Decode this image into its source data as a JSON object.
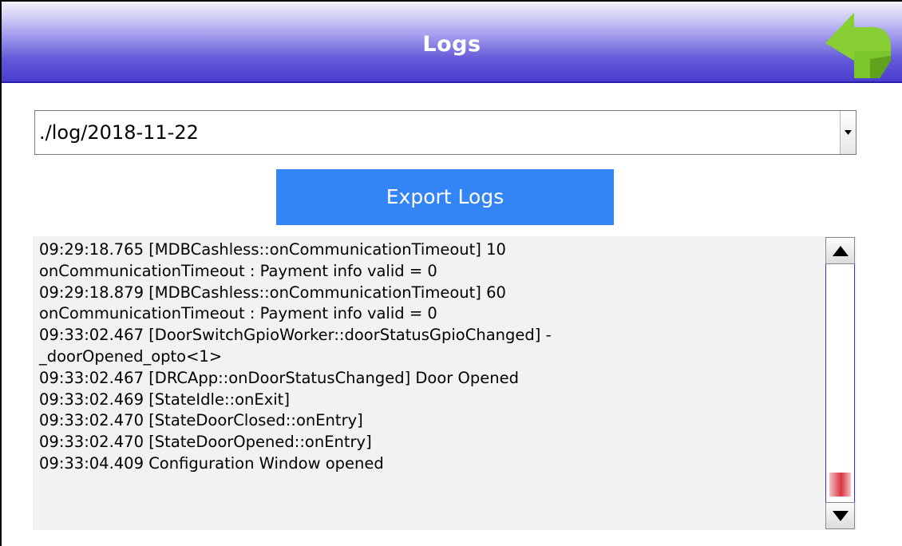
{
  "header": {
    "title": "Logs",
    "back_icon": "back-arrow-icon",
    "back_icon_color": "#7cc52a"
  },
  "log_file_select": {
    "value": "./log/2018-11-22",
    "arrow_icon": "chevron-down-icon"
  },
  "export_button": {
    "label": "Export Logs",
    "color": "#3384f5"
  },
  "log": {
    "lines": [
      "09:29:18.765 [MDBCashless::onCommunicationTimeout] 10",
      "onCommunicationTimeout : Payment info valid = 0",
      "09:29:18.879 [MDBCashless::onCommunicationTimeout] 60",
      "onCommunicationTimeout : Payment info valid = 0",
      "09:33:02.467 [DoorSwitchGpioWorker::doorStatusGpioChanged] -",
      "_doorOpened_opto<1>",
      "09:33:02.467 [DRCApp::onDoorStatusChanged] Door Opened",
      "09:33:02.469 [StateIdle::onExit]",
      "09:33:02.470 [StateDoorClosed::onEntry]",
      "09:33:02.470 [StateDoorOpened::onEntry]",
      "09:33:04.409 Configuration Window opened"
    ],
    "scroll_position": 0.98
  },
  "scrollbar": {
    "up_icon": "scroll-up-arrow-icon",
    "down_icon": "scroll-down-arrow-icon",
    "thumb_color": "#d9343f"
  }
}
